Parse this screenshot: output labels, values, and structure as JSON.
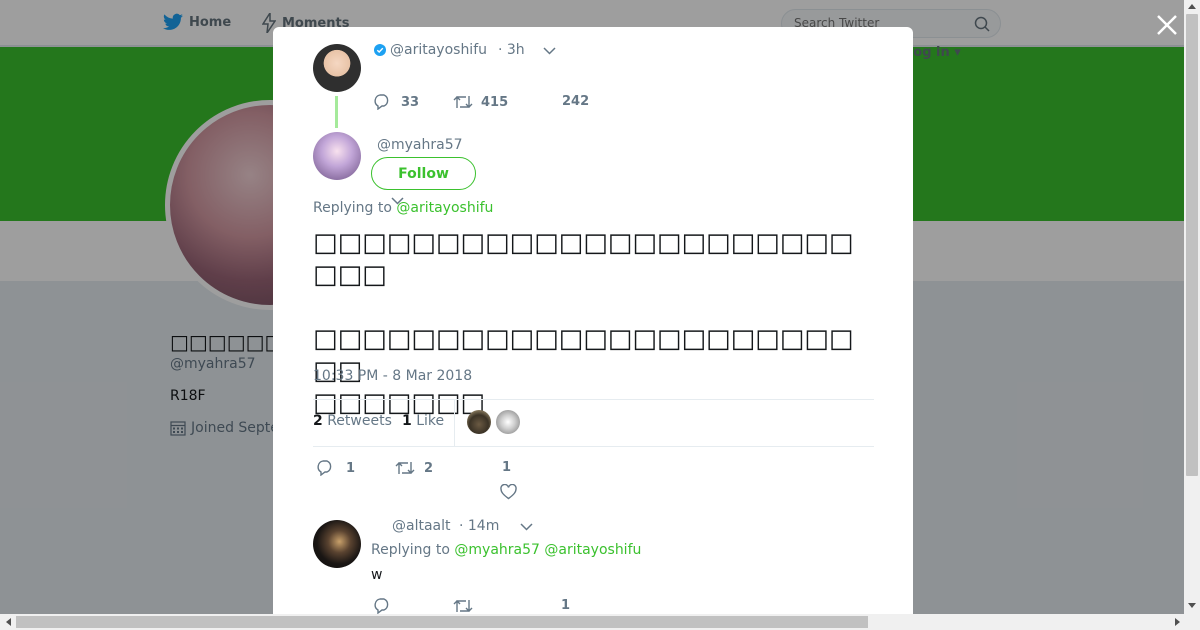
{
  "nav": {
    "home_label": "Home",
    "moments_label": "Moments",
    "search_placeholder": "Search Twitter",
    "login_label": "Log in"
  },
  "profile": {
    "name": "□□□□□□",
    "handle": "@myahra57",
    "bio": "R18F",
    "joined": "Joined Septe"
  },
  "modal": {
    "parent_tweet": {
      "handle": "@aritayoshifu",
      "time": "· 3h",
      "replies": "33",
      "retweets": "415",
      "likes": "242"
    },
    "main_tweet": {
      "handle": "@myahra57",
      "follow_label": "Follow",
      "replying_prefix": "Replying to",
      "replying_to": "@aritayoshifu",
      "text": "□□□□□□□□□□□□□□□□□□□□□□□□□\n\n□□□□□□□□□□□□□□□□□□□□□□□□\n□□□□□□□",
      "timestamp": "10:33 PM - 8 Mar 2018",
      "retweet_count": "2",
      "retweet_label": "Retweets",
      "like_count": "1",
      "like_label": "Like",
      "replies": "1",
      "retweets": "2",
      "likes": "1"
    },
    "reply_tweet": {
      "handle": "@altaalt",
      "time": "· 14m",
      "replying_prefix": "Replying to",
      "replying_to_1": "@myahra57",
      "replying_to_2": "@aritayoshifu",
      "text": "w",
      "likes": "1"
    }
  },
  "colors": {
    "accent": "#3bc12e",
    "verified": "#1da1f2"
  },
  "icons": [
    "twitter-bird-icon",
    "lightning-icon",
    "search-icon",
    "close-icon",
    "verified-icon",
    "chevron-down-icon",
    "reply-icon",
    "retweet-icon",
    "heart-icon",
    "calendar-icon"
  ]
}
